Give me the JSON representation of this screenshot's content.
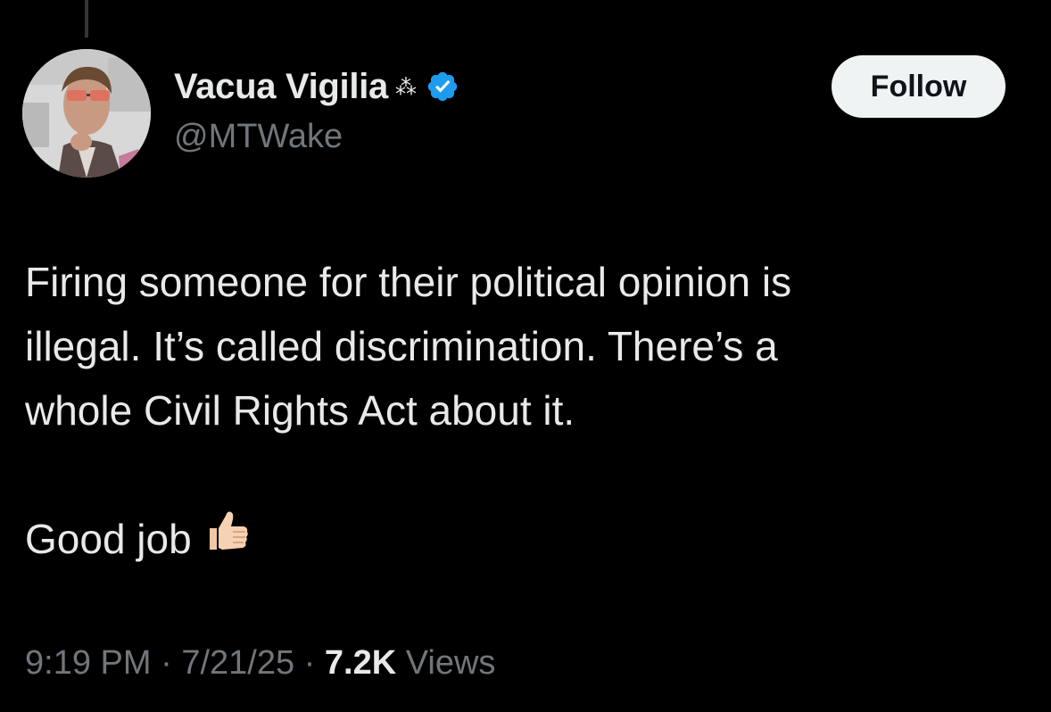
{
  "author": {
    "display_name": "Vacua Vigilia",
    "name_emoji": "⁂",
    "handle": "@MTWake",
    "verified_icon": "verified-badge-icon",
    "verified_color": "#1d9bf0"
  },
  "follow_button": {
    "label": "Follow"
  },
  "tweet": {
    "lines": [
      "Firing someone for their political opinion is",
      "illegal. It’s called discrimination. There’s a",
      "whole Civil Rights Act about it."
    ],
    "closing": "Good job",
    "closing_emoji": "thumbs-up-icon"
  },
  "meta": {
    "time": "9:19 PM",
    "separator": "·",
    "date": "7/21/25",
    "views_count": "7.2K",
    "views_label": "Views"
  },
  "colors": {
    "background": "#000000",
    "primary_text": "#e7e9ea",
    "secondary_text": "#71767b",
    "follow_bg": "#eff3f4"
  }
}
